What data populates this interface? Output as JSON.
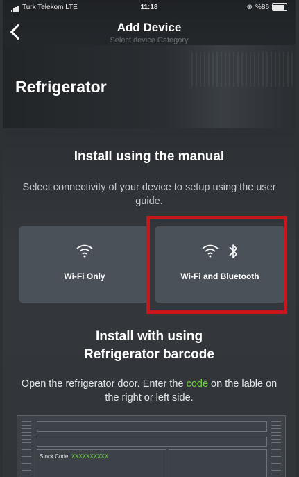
{
  "status_bar": {
    "carrier": "Turk Telekom LTE",
    "time": "11:18",
    "battery": "%86"
  },
  "header": {
    "title": "Add Device",
    "subtitle": "Select device Category"
  },
  "device": {
    "name": "Refrigerator"
  },
  "manual": {
    "heading": "Install using the manual",
    "description": "Select connectivity of your device to setup using the user guide.",
    "options": [
      {
        "label": "Wi-Fi Only",
        "icons": [
          "wifi-icon"
        ]
      },
      {
        "label": "Wi-Fi and Bluetooth",
        "icons": [
          "wifi-icon",
          "bluetooth-icon"
        ]
      }
    ]
  },
  "barcode": {
    "heading_line1": "Install with using",
    "heading_line2": "Refrigerator barcode",
    "desc_before": "Open the refrigerator door. Enter the ",
    "desc_code": "code",
    "desc_after": " on the lable on the right or left side.",
    "stock_label": "Stock Code:",
    "stock_value": "XXXXXXXXXX"
  },
  "colors": {
    "highlight": "#c9161b",
    "code_accent": "#6fd23e",
    "card": "#4b5159"
  }
}
